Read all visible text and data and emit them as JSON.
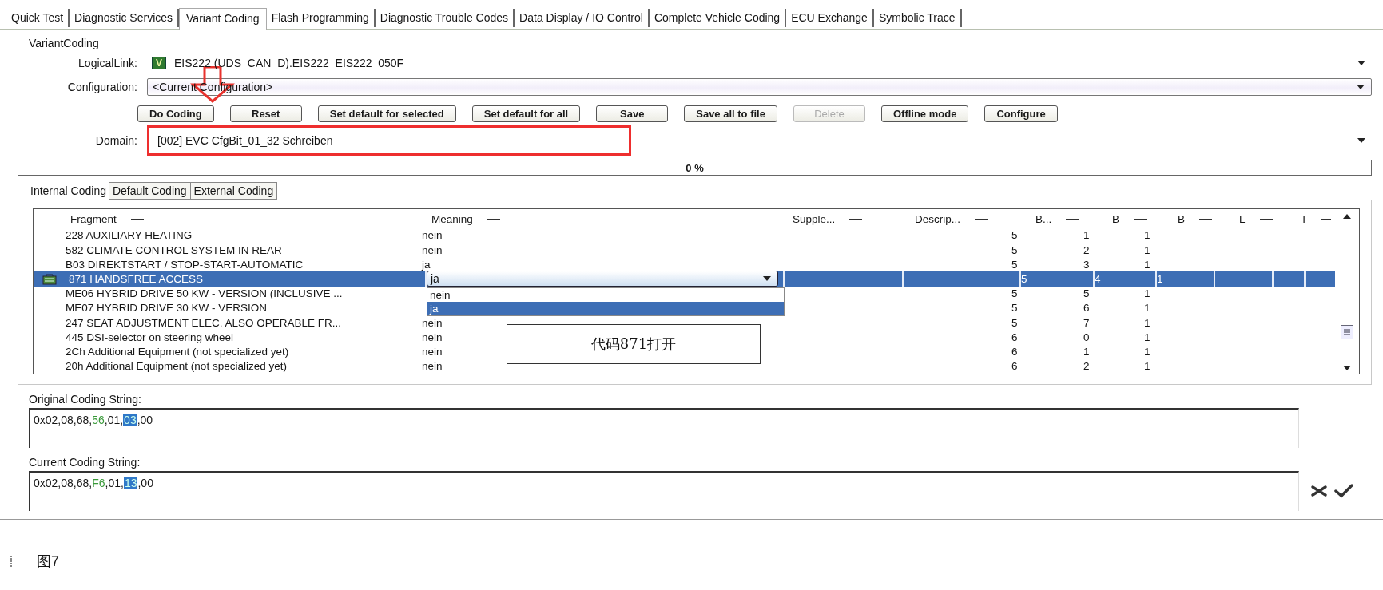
{
  "tabs": [
    {
      "label": "Quick Test",
      "selected": false
    },
    {
      "label": "Diagnostic Services",
      "selected": false
    },
    {
      "label": "Variant Coding",
      "selected": true
    },
    {
      "label": "Flash Programming",
      "selected": false
    },
    {
      "label": "Diagnostic Trouble Codes",
      "selected": false
    },
    {
      "label": "Data Display / IO Control",
      "selected": false
    },
    {
      "label": "Complete Vehicle Coding",
      "selected": false
    },
    {
      "label": "ECU Exchange",
      "selected": false
    },
    {
      "label": "Symbolic Trace",
      "selected": false
    }
  ],
  "section_title": "VariantCoding",
  "logical_link": {
    "label": "LogicalLink:",
    "badge": "V",
    "value": "EIS222 (UDS_CAN_D).EIS222_EIS222_050F"
  },
  "configuration": {
    "label": "Configuration:",
    "value": "<Current Configuration>"
  },
  "buttons": [
    {
      "label": "Do Coding",
      "disabled": false
    },
    {
      "label": "Reset",
      "disabled": false
    },
    {
      "label": "Set default for selected",
      "disabled": false
    },
    {
      "label": "Set default for all",
      "disabled": false
    },
    {
      "label": "Save",
      "disabled": false
    },
    {
      "label": "Save all to file",
      "disabled": false
    },
    {
      "label": "Delete",
      "disabled": true
    },
    {
      "label": "Offline mode",
      "disabled": false
    },
    {
      "label": "Configure",
      "disabled": false
    }
  ],
  "domain": {
    "label": "Domain:",
    "value": "[002] EVC CfgBit_01_32 Schreiben",
    "highlighted": true
  },
  "progress": {
    "level": 0,
    "reading": "0 %"
  },
  "sub_tabs": [
    {
      "label": "Internal Coding",
      "selected": true
    },
    {
      "label": "Default Coding",
      "selected": false
    },
    {
      "label": "External Coding",
      "selected": false
    }
  ],
  "table": {
    "columns": [
      "Fragment",
      "Meaning",
      "Supple...",
      "Descrip...",
      "B...",
      "B",
      "B",
      "L",
      "T"
    ],
    "rows": [
      {
        "fragment": "228 AUXILIARY HEATING",
        "meaning": "nein",
        "b1": "5",
        "b2": "1",
        "b3": "1",
        "selected": false
      },
      {
        "fragment": "582 CLIMATE CONTROL SYSTEM IN REAR",
        "meaning": "nein",
        "b1": "5",
        "b2": "2",
        "b3": "1",
        "selected": false
      },
      {
        "fragment": "B03 DIREKTSTART / STOP-START-AUTOMATIC",
        "meaning": "ja",
        "b1": "5",
        "b2": "3",
        "b3": "1",
        "selected": false
      },
      {
        "fragment": "871 HANDSFREE ACCESS",
        "meaning_dropdown": {
          "value": "ja",
          "options": [
            {
              "label": "nein",
              "selected": false
            },
            {
              "label": "ja",
              "selected": true
            }
          ]
        },
        "b1": "5",
        "b2": "4",
        "b3": "1",
        "selected": true
      },
      {
        "fragment": "ME06 HYBRID DRIVE 50 KW - VERSION (INCLUSIVE ...",
        "b1": "5",
        "b2": "5",
        "b3": "1",
        "selected": false
      },
      {
        "fragment": "ME07 HYBRID DRIVE 30 KW - VERSION",
        "b1": "5",
        "b2": "6",
        "b3": "1",
        "selected": false
      },
      {
        "fragment": "247 SEAT ADJUSTMENT ELEC. ALSO OPERABLE FR...",
        "meaning": "nein",
        "b1": "5",
        "b2": "7",
        "b3": "1",
        "selected": false
      },
      {
        "fragment": "445 DSI-selector on steering wheel",
        "meaning": "nein",
        "b1": "6",
        "b2": "0",
        "b3": "1",
        "selected": false
      },
      {
        "fragment": "2Ch Additional Equipment (not specialized yet)",
        "meaning": "nein",
        "b1": "6",
        "b2": "1",
        "b3": "1",
        "selected": false
      },
      {
        "fragment": "20h Additional Equipment (not specialized yet)",
        "meaning": "nein",
        "b1": "6",
        "b2": "2",
        "b3": "1",
        "selected": false
      }
    ]
  },
  "annotation": "代码871打开",
  "original_coding": {
    "label": "Original Coding String:",
    "parts": [
      {
        "text": "0x02,08,68,",
        "kind": "plain"
      },
      {
        "text": "56",
        "kind": "changed"
      },
      {
        "text": ",01,",
        "kind": "plain"
      },
      {
        "text": "03",
        "kind": "selected"
      },
      {
        "text": ",00",
        "kind": "plain"
      }
    ]
  },
  "current_coding": {
    "label": "Current Coding String:",
    "parts": [
      {
        "text": "0x02,08,68,",
        "kind": "plain"
      },
      {
        "text": "F6",
        "kind": "changed"
      },
      {
        "text": ",01,",
        "kind": "plain"
      },
      {
        "text": "13",
        "kind": "selected"
      },
      {
        "text": ",00",
        "kind": "plain"
      }
    ]
  },
  "caption": "图7"
}
